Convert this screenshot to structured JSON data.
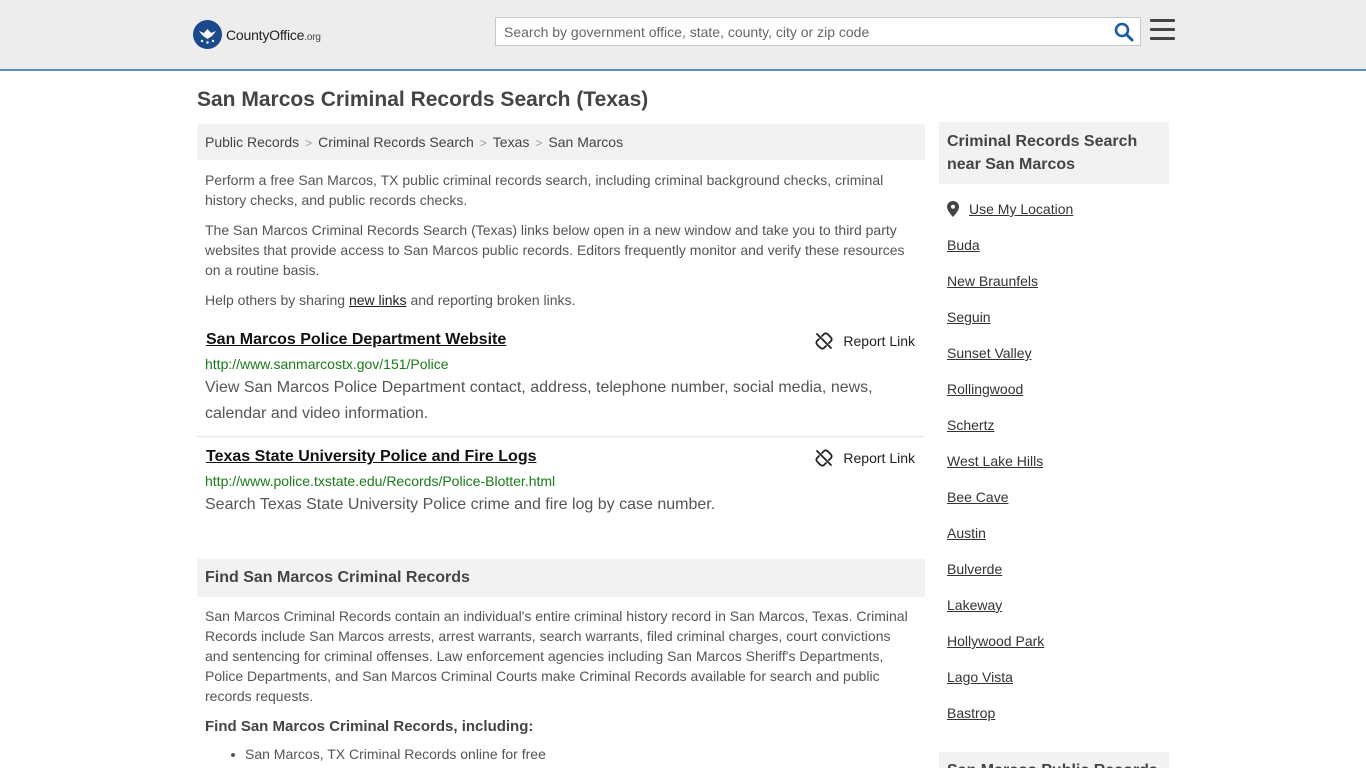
{
  "header": {
    "logo_name": "CountyOffice",
    "logo_suffix": ".org",
    "search_placeholder": "Search by government office, state, county, city or zip code"
  },
  "page": {
    "title": "San Marcos Criminal Records Search (Texas)"
  },
  "breadcrumb": [
    {
      "label": "Public Records"
    },
    {
      "label": "Criminal Records Search"
    },
    {
      "label": "Texas"
    },
    {
      "label": "San Marcos"
    }
  ],
  "intro": {
    "p1": "Perform a free San Marcos, TX public criminal records search, including criminal background checks, criminal history checks, and public records checks.",
    "p2": "The San Marcos Criminal Records Search (Texas) links below open in a new window and take you to third party websites that provide access to San Marcos public records. Editors frequently monitor and verify these resources on a routine basis.",
    "p3_pre": "Help others by sharing ",
    "p3_link": "new links",
    "p3_post": " and reporting broken links."
  },
  "results": [
    {
      "title": "San Marcos Police Department Website",
      "report": "Report Link",
      "url": "http://www.sanmarcostx.gov/151/Police",
      "desc": "View San Marcos Police Department contact, address, telephone number, social media, news, calendar and video information."
    },
    {
      "title": "Texas State University Police and Fire Logs",
      "report": "Report Link",
      "url": "http://www.police.txstate.edu/Records/Police-Blotter.html",
      "desc": "Search Texas State University Police crime and fire log by case number."
    }
  ],
  "find": {
    "header": "Find San Marcos Criminal Records",
    "text": "San Marcos Criminal Records contain an individual's entire criminal history record in San Marcos, Texas. Criminal Records include San Marcos arrests, arrest warrants, search warrants, filed criminal charges, court convictions and sentencing for criminal offenses. Law enforcement agencies including San Marcos Sheriff's Departments, Police Departments, and San Marcos Criminal Courts make Criminal Records available for search and public records requests.",
    "subheader": "Find San Marcos Criminal Records, including:",
    "items": [
      "San Marcos, TX Criminal Records online for free"
    ]
  },
  "sidebar": {
    "header": "Criminal Records Search near San Marcos",
    "use_location": "Use My Location",
    "cities": [
      "Buda",
      "New Braunfels",
      "Seguin",
      "Sunset Valley",
      "Rollingwood",
      "Schertz",
      "West Lake Hills",
      "Bee Cave",
      "Austin",
      "Bulverde",
      "Lakeway",
      "Hollywood Park",
      "Lago Vista",
      "Bastrop"
    ],
    "header2": "San Marcos Public Records"
  }
}
